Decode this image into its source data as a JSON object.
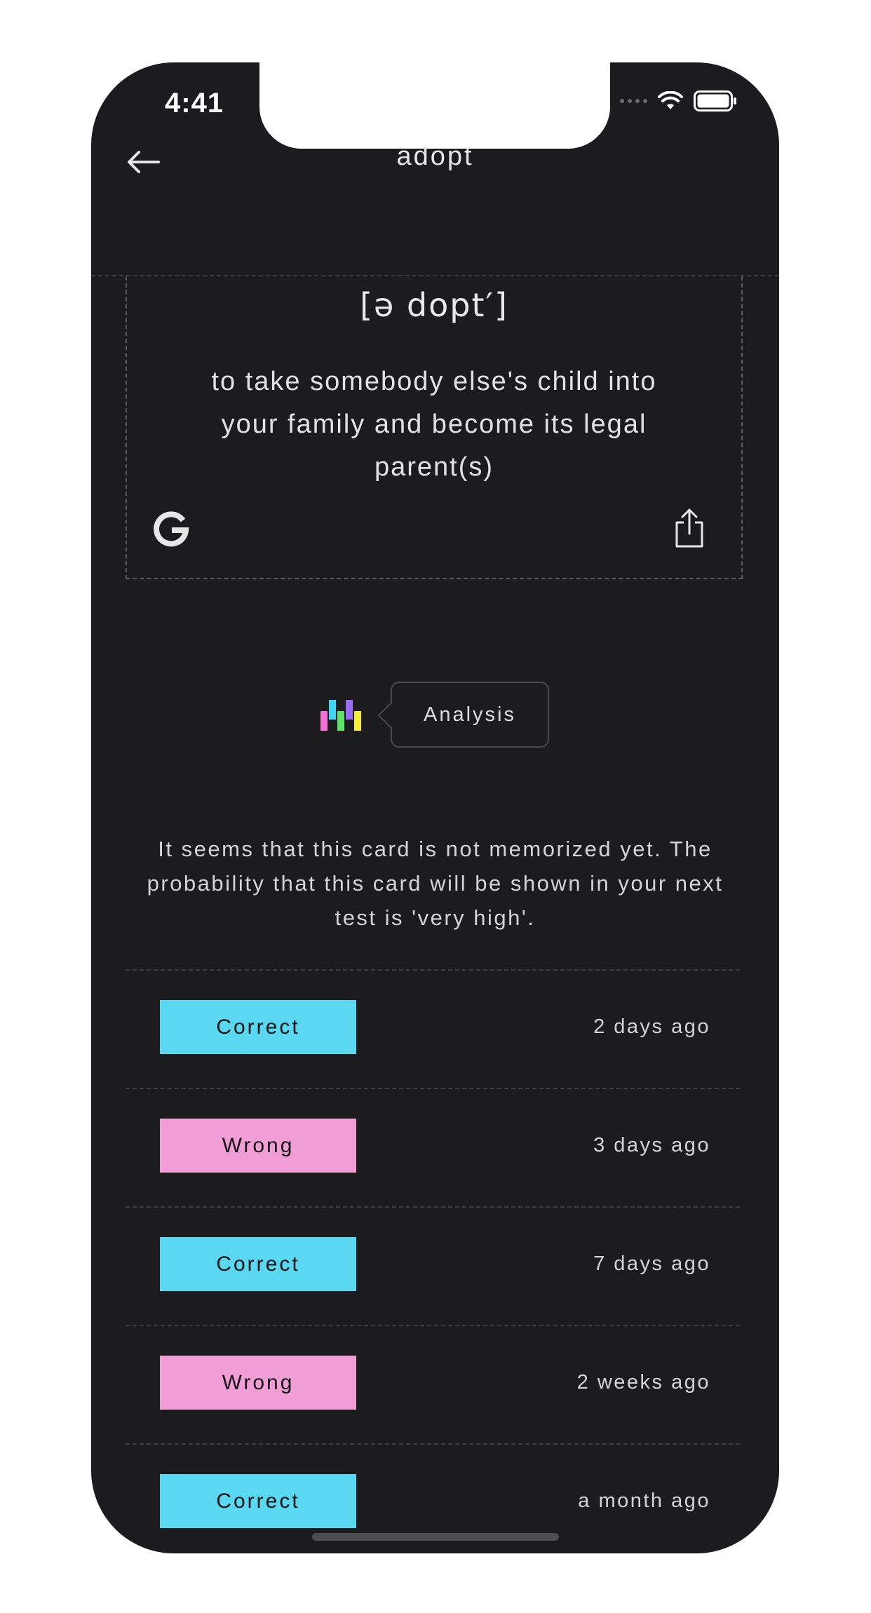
{
  "status_bar": {
    "time": "4:41"
  },
  "header": {
    "title": "adopt"
  },
  "card": {
    "phonetic": "[ə dopt′]",
    "definition": "to take somebody else's child into your family and become its legal parent(s)"
  },
  "analysis": {
    "label": "Analysis",
    "message": "It seems that this card is not memorized yet. The probability that this card will be shown in your next test is 'very high'."
  },
  "history": [
    {
      "result": "Correct",
      "time": "2 days ago",
      "color": "#5ad8f2"
    },
    {
      "result": "Wrong",
      "time": "3 days ago",
      "color": "#f19ed7"
    },
    {
      "result": "Correct",
      "time": "7 days ago",
      "color": "#5ad8f2"
    },
    {
      "result": "Wrong",
      "time": "2 weeks ago",
      "color": "#f19ed7"
    },
    {
      "result": "Correct",
      "time": "a month ago",
      "color": "#5ad8f2"
    }
  ],
  "colors": {
    "background": "#1c1c1e",
    "correct": "#5ad8f2",
    "wrong": "#f19ed7"
  },
  "icons": {
    "back": "arrow-left-icon",
    "google": "google-icon",
    "share": "share-icon",
    "analysis": "bar-chart-logo-icon"
  }
}
